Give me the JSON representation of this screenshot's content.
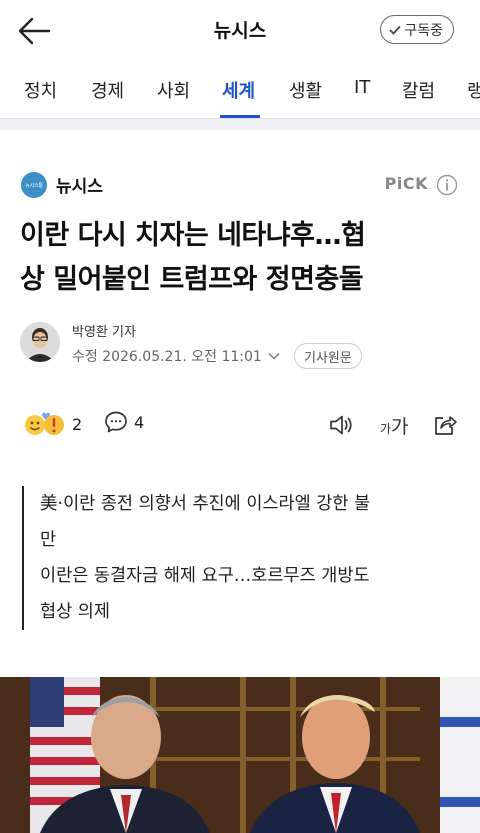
{
  "header": {
    "title": "뉴시스",
    "subscribe_label": "구독중"
  },
  "tabs": [
    {
      "label": "정치"
    },
    {
      "label": "경제"
    },
    {
      "label": "사회"
    },
    {
      "label": "세계",
      "active": true
    },
    {
      "label": "생활"
    },
    {
      "label": "IT"
    },
    {
      "label": "칼럼"
    },
    {
      "label": "랭"
    }
  ],
  "article": {
    "publisher": "뉴시스",
    "publisher_logo_text": "뉴시스통",
    "pick_label": "PiCK",
    "headline_line1": "이란 다시 치자는 네타냐후…협",
    "headline_line2": "상 밀어붙인 트럼프와 정면충돌",
    "reporter": "박영환 기자",
    "date_label": "수정 2026.05.21. 오전 11:01",
    "original_label": "기사원문",
    "reaction_count": "2",
    "comment_count": "4",
    "font_size_small": "가",
    "font_size_large": "가",
    "summary": [
      "美·이란 종전 의향서 추진에 이스라엘 강한 불",
      "만",
      "이란은 동결자금 해제 요구…호르무즈 개방도",
      "협상 의제"
    ]
  },
  "colors": {
    "accent": "#2152c9",
    "logo_blue": "#3c8fc7"
  },
  "icons": [
    "back-arrow-icon",
    "check-icon",
    "info-icon",
    "emoji-reaction-icon",
    "comment-icon",
    "tts-speaker-icon",
    "share-icon",
    "chevron-down-icon"
  ]
}
